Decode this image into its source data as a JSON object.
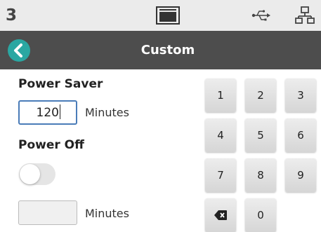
{
  "status_bar": {
    "number": "3",
    "icons": [
      "screen-icon",
      "usb-icon",
      "network-icon"
    ]
  },
  "header": {
    "title": "Custom",
    "back_icon": "chevron-left-icon",
    "accent_color": "#2aa7a2",
    "bar_color": "#4d4d4d"
  },
  "power_saver": {
    "label": "Power Saver",
    "value": "120",
    "unit": "Minutes"
  },
  "power_off": {
    "label": "Power Off",
    "toggle_on": false,
    "value": "",
    "unit": "Minutes"
  },
  "keypad": {
    "keys": [
      "1",
      "2",
      "3",
      "4",
      "5",
      "6",
      "7",
      "8",
      "9"
    ],
    "zero": "0",
    "backspace_icon": "backspace-icon"
  }
}
